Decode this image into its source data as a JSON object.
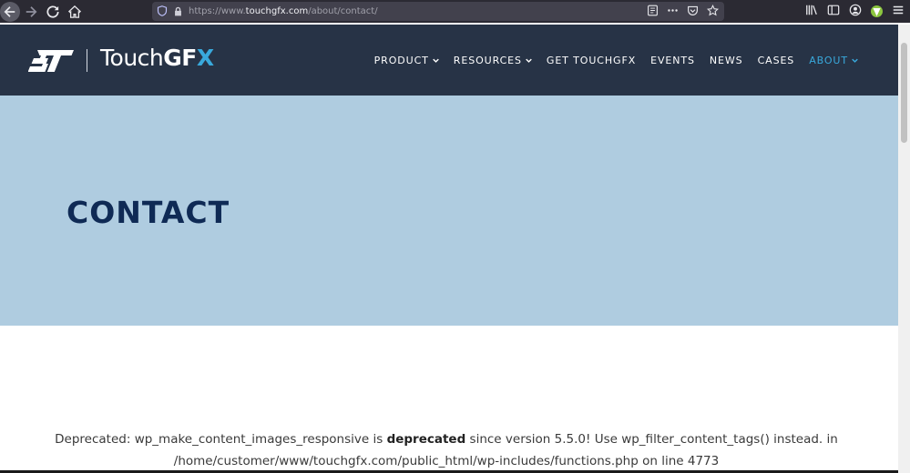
{
  "browser": {
    "url_prefix": "https://www.",
    "url_host": "touchgfx.com",
    "url_path": "/about/contact/"
  },
  "header": {
    "logo_st": "ST",
    "logo_touch": "Touch",
    "logo_gf": "GF",
    "logo_x": "X",
    "nav": [
      {
        "label": "PRODUCT"
      },
      {
        "label": "RESOURCES"
      },
      {
        "label": "GET TOUCHGFX"
      },
      {
        "label": "EVENTS"
      },
      {
        "label": "NEWS"
      },
      {
        "label": "CASES"
      },
      {
        "label": "ABOUT"
      }
    ]
  },
  "hero": {
    "title": "CONTACT"
  },
  "content": {
    "msg_prefix": "Deprecated: wp_make_content_images_responsive is ",
    "msg_bold": "deprecated",
    "msg_suffix": " since version 5.5.0! Use wp_filter_content_tags() instead. in /home/customer/www/touchgfx.com/public_html/wp-includes/functions.php on line 4773"
  },
  "colors": {
    "header_bg": "#273346",
    "accent": "#39a9dc",
    "hero_bg": "#afcce0",
    "title": "#0f2a55"
  }
}
